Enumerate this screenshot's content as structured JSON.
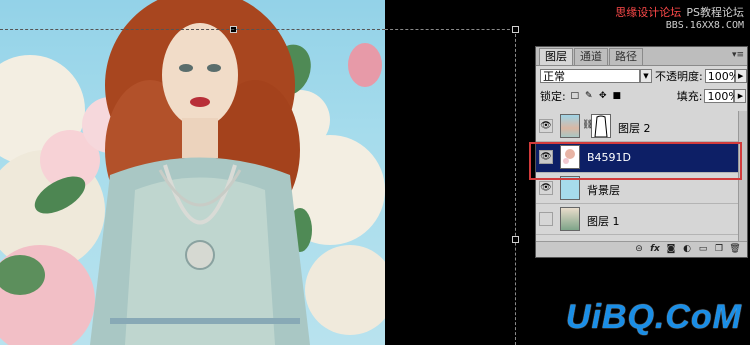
{
  "watermark": {
    "cn_site": "思缘设计论坛",
    "ps_forum": "PS教程论坛",
    "bbs": "BBS.16XX8.COM",
    "logo": "UiBQ.CoM"
  },
  "panel": {
    "tabs": [
      "图层",
      "通道",
      "路径"
    ],
    "active_tab": 0,
    "blend_mode": "正常",
    "opacity_label": "不透明度:",
    "opacity_value": "100%",
    "lock_label": "锁定:",
    "fill_label": "填充:",
    "fill_value": "100%",
    "layers": [
      {
        "name": "图层 2",
        "visible": true,
        "selected": false,
        "has_mask": true
      },
      {
        "name": "B4591D",
        "visible": true,
        "selected": true,
        "has_mask": false
      },
      {
        "name": "背景层",
        "visible": true,
        "selected": false,
        "has_mask": false
      },
      {
        "name": "图层 1",
        "visible": false,
        "selected": false,
        "has_mask": false
      }
    ]
  },
  "colors": {
    "selected_layer": "#0d1f66",
    "highlight_box": "#d23b3b",
    "canvas_sky": "#9ed6ea"
  },
  "icons": [
    "eye-icon",
    "chain-icon",
    "link-layers-icon",
    "fx-icon",
    "mask-icon",
    "adjustment-icon",
    "folder-icon",
    "new-layer-icon",
    "trash-icon"
  ]
}
